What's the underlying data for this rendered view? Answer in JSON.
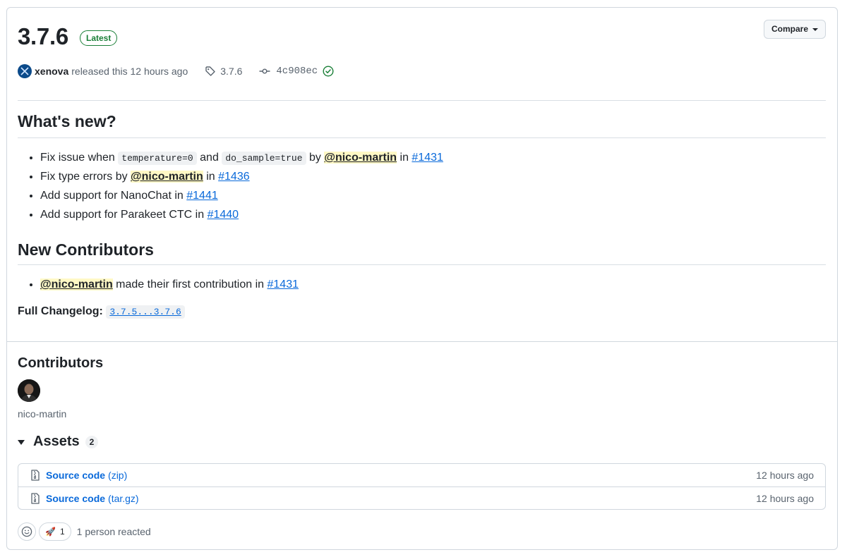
{
  "release": {
    "title": "3.7.6",
    "badge": "Latest",
    "compare_label": "Compare",
    "author": "xenova",
    "released_text": "released this 12 hours ago",
    "tag": "3.7.6",
    "commit": "4c908ec"
  },
  "whats_new": {
    "heading": "What's new?",
    "items": [
      {
        "t1": "Fix issue when",
        "code1": "temperature=0",
        "t2": "and",
        "code2": "do_sample=true",
        "t3": "by",
        "mention": "@nico-martin",
        "t4": "in",
        "pr": "#1431"
      },
      {
        "t1": "Fix type errors by",
        "mention": "@nico-martin",
        "t2": "in",
        "pr": "#1436"
      },
      {
        "t1": "Add support for NanoChat in",
        "pr": "#1441"
      },
      {
        "t1": "Add support for Parakeet CTC in",
        "pr": "#1440"
      }
    ]
  },
  "new_contributors": {
    "heading": "New Contributors",
    "items": [
      {
        "mention": "@nico-martin",
        "t1": "made their first contribution in",
        "pr": "#1431"
      }
    ]
  },
  "changelog": {
    "label": "Full Changelog:",
    "range": "3.7.5...3.7.6"
  },
  "contributors": {
    "heading": "Contributors",
    "users": [
      {
        "name": "nico-martin"
      }
    ]
  },
  "assets": {
    "heading": "Assets",
    "count": "2",
    "items": [
      {
        "name": "Source code",
        "ext": "(zip)",
        "when": "12 hours ago"
      },
      {
        "name": "Source code",
        "ext": "(tar.gz)",
        "when": "12 hours ago"
      }
    ]
  },
  "reactions": {
    "emoji": "🚀",
    "count": "1",
    "summary": "1 person reacted"
  },
  "colors": {
    "link": "#0969da",
    "success": "#1a7f37",
    "mention_bg": "#fff8c5"
  }
}
